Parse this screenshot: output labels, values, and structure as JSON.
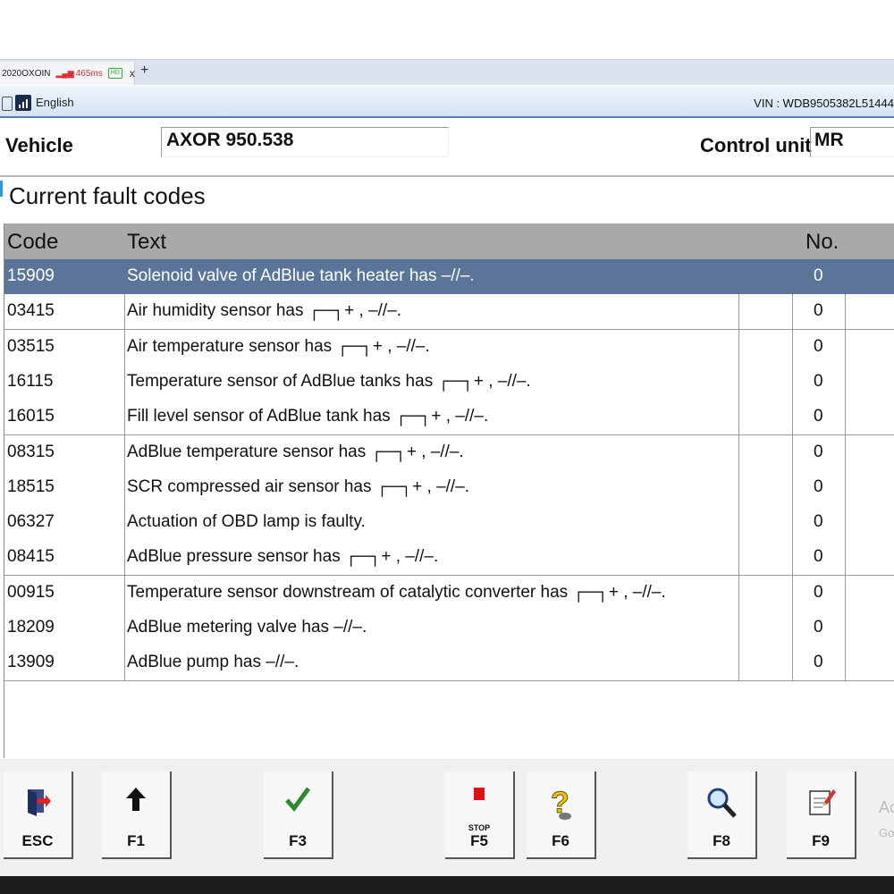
{
  "browser_tab": {
    "title": "2020OXOIN",
    "latency": "465ms",
    "hd_badge": "HD",
    "close_icon": "x",
    "new_tab": "+"
  },
  "app_bar": {
    "language": "English",
    "vin": "VIN : WDB9505382L51444"
  },
  "vehicle": {
    "label": "Vehicle",
    "value": "AXOR 950.538",
    "control_unit_label": "Control unit",
    "control_unit_value": "MR"
  },
  "section_title": "Current fault codes",
  "table": {
    "headers": {
      "code": "Code",
      "text": "Text",
      "no": "No."
    },
    "rows": [
      {
        "code": "15909",
        "text": "Solenoid valve of AdBlue tank heater has –//–.",
        "no": "0",
        "selected": true
      },
      {
        "code": "03415",
        "text": "Air humidity sensor has ┌─┐+ , –//–.",
        "no": "0"
      },
      {
        "code": "03515",
        "text": "Air temperature sensor has ┌─┐+ , –//–.",
        "no": "0"
      },
      {
        "code": "16115",
        "text": "Temperature sensor of AdBlue tanks has ┌─┐+ , –//–.",
        "no": "0"
      },
      {
        "code": "16015",
        "text": "Fill level sensor of AdBlue tank has ┌─┐+ , –//–.",
        "no": "0"
      },
      {
        "code": "08315",
        "text": "AdBlue temperature sensor has ┌─┐+ , –//–.",
        "no": "0"
      },
      {
        "code": "18515",
        "text": "SCR compressed air sensor has ┌─┐+ , –//–.",
        "no": "0"
      },
      {
        "code": "06327",
        "text": "Actuation of OBD lamp is faulty.",
        "no": "0"
      },
      {
        "code": "08415",
        "text": "AdBlue pressure sensor has ┌─┐+ , –//–.",
        "no": "0"
      },
      {
        "code": "00915",
        "text": "Temperature sensor downstream of catalytic converter has ┌─┐+ , –//–.",
        "no": "0"
      },
      {
        "code": "18209",
        "text": "AdBlue metering valve has –//–.",
        "no": "0"
      },
      {
        "code": "13909",
        "text": "AdBlue pump has –//–.",
        "no": "0"
      }
    ]
  },
  "function_keys": [
    {
      "label": "ESC",
      "icon": "exit-door-icon"
    },
    {
      "label": "F1",
      "icon": "up-arrow-icon"
    },
    {
      "label": "F3",
      "icon": "checkmark-icon"
    },
    {
      "label": "F5",
      "icon": "stop-icon",
      "icon_text": "STOP"
    },
    {
      "label": "F6",
      "icon": "help-question-icon"
    },
    {
      "label": "F8",
      "icon": "magnifier-icon"
    },
    {
      "label": "F9",
      "icon": "print-edit-icon"
    }
  ],
  "overlay_text": {
    "line1": "Ac",
    "line2": "Go"
  },
  "colors": {
    "selected_row": "#5b7599",
    "header_bg": "#a9a9a9",
    "app_bar_border": "#5f7ca8"
  }
}
